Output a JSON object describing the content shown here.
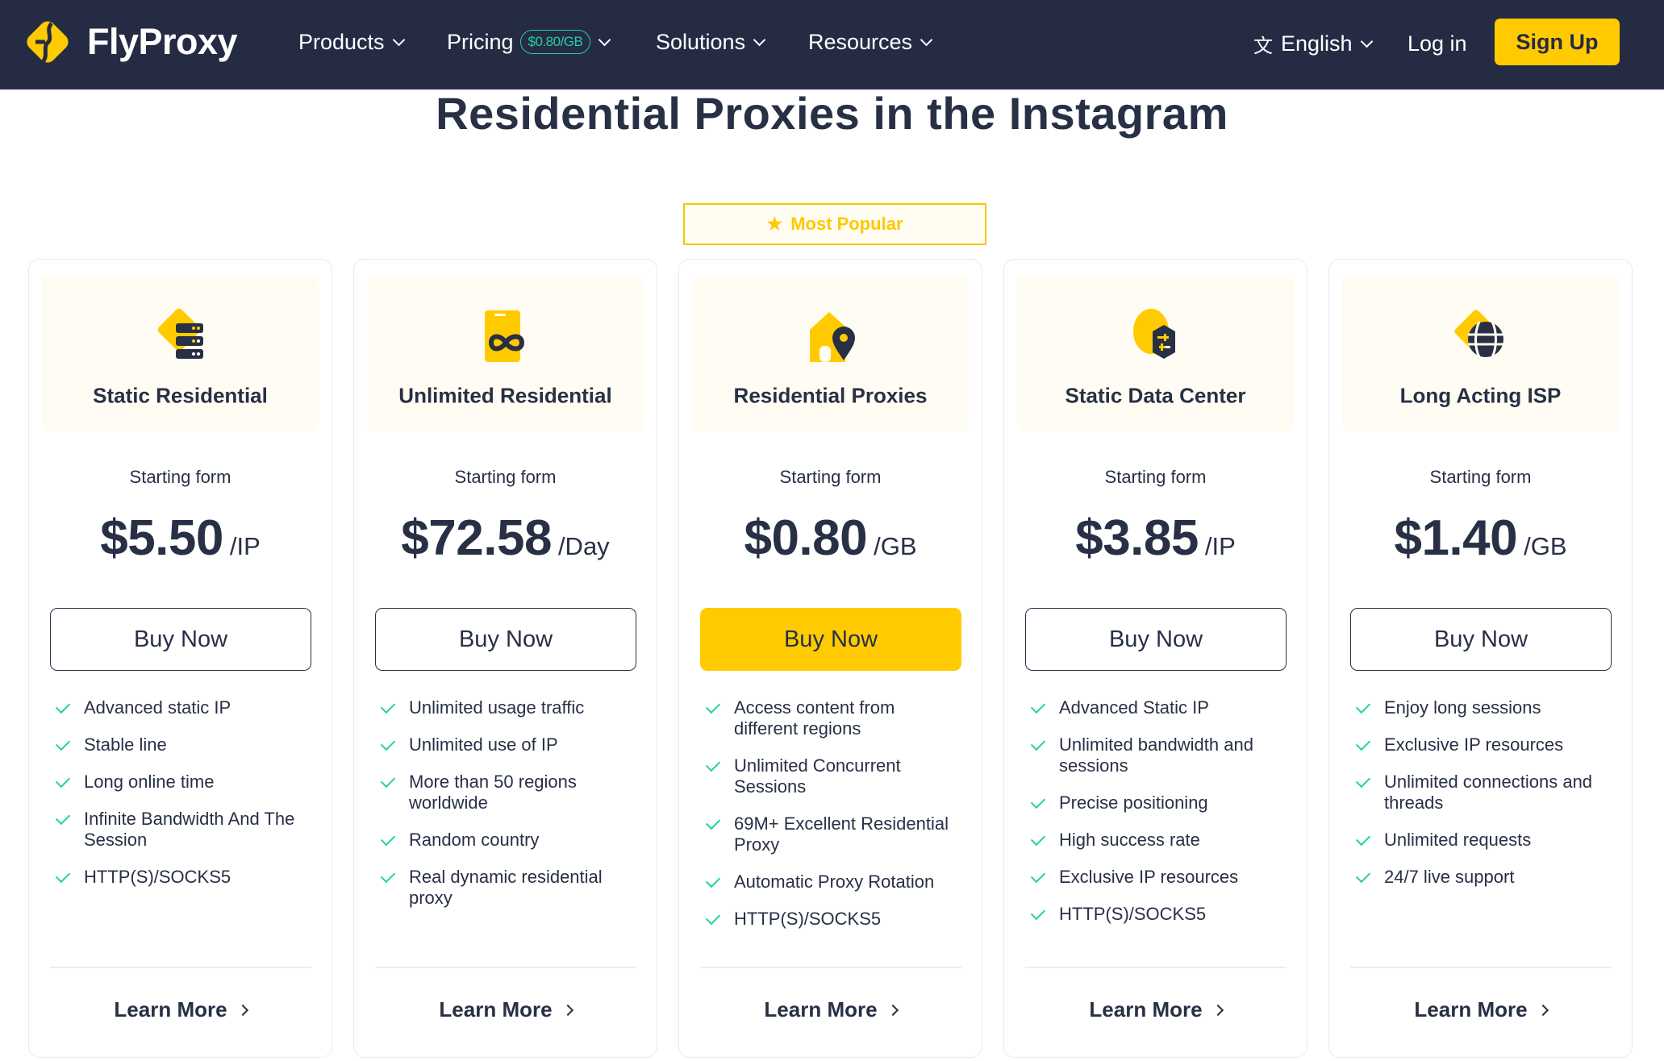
{
  "header": {
    "brand": "FlyProxy",
    "nav": [
      {
        "label": "Products"
      },
      {
        "label": "Pricing",
        "badge": "$0.80/GB"
      },
      {
        "label": "Solutions"
      },
      {
        "label": "Resources"
      }
    ],
    "language": "English",
    "login_label": "Log in",
    "signup_label": "Sign Up",
    "accent_color": "#ffcb00",
    "badge_color": "#1fd1a0"
  },
  "page": {
    "title": "Residential Proxies in the Instagram",
    "most_popular_label": "Most Popular",
    "most_popular_icon": "star-icon"
  },
  "cards": [
    {
      "name": "Static Residential",
      "icon": "server-stack-icon",
      "starting_label": "Starting form",
      "price": "$5.50",
      "unit": "/IP",
      "buy_label": "Buy Now",
      "primary": false,
      "features": [
        "Advanced static IP",
        "Stable line",
        "Long online time",
        "Infinite Bandwidth And The Session",
        "HTTP(S)/SOCKS5"
      ],
      "learn_more_label": "Learn More"
    },
    {
      "name": "Unlimited Residential",
      "icon": "phone-infinity-icon",
      "starting_label": "Starting form",
      "price": "$72.58",
      "unit": "/Day",
      "buy_label": "Buy Now",
      "primary": false,
      "features": [
        "Unlimited usage traffic",
        "Unlimited use of IP",
        "More than 50 regions worldwide",
        "Random country",
        "Real dynamic residential proxy"
      ],
      "learn_more_label": "Learn More"
    },
    {
      "name": "Residential Proxies",
      "icon": "house-pin-icon",
      "starting_label": "Starting form",
      "price": "$0.80",
      "unit": "/GB",
      "buy_label": "Buy Now",
      "primary": true,
      "features": [
        "Access content from different regions",
        "Unlimited Concurrent Sessions",
        "69M+ Excellent Residential Proxy",
        "Automatic Proxy Rotation",
        "HTTP(S)/SOCKS5"
      ],
      "learn_more_label": "Learn More"
    },
    {
      "name": "Static Data Center",
      "icon": "datacenter-sliders-icon",
      "starting_label": "Starting form",
      "price": "$3.85",
      "unit": "/IP",
      "buy_label": "Buy Now",
      "primary": false,
      "features": [
        "Advanced Static IP",
        "Unlimited bandwidth and sessions",
        "Precise positioning",
        "High success rate",
        "Exclusive IP resources",
        "HTTP(S)/SOCKS5"
      ],
      "learn_more_label": "Learn More"
    },
    {
      "name": "Long Acting ISP",
      "icon": "globe-icon",
      "starting_label": "Starting form",
      "price": "$1.40",
      "unit": "/GB",
      "buy_label": "Buy Now",
      "primary": false,
      "features": [
        "Enjoy long sessions",
        "Exclusive IP resources",
        "Unlimited connections and threads",
        "Unlimited requests",
        "24/7 live support"
      ],
      "learn_more_label": "Learn More"
    }
  ]
}
